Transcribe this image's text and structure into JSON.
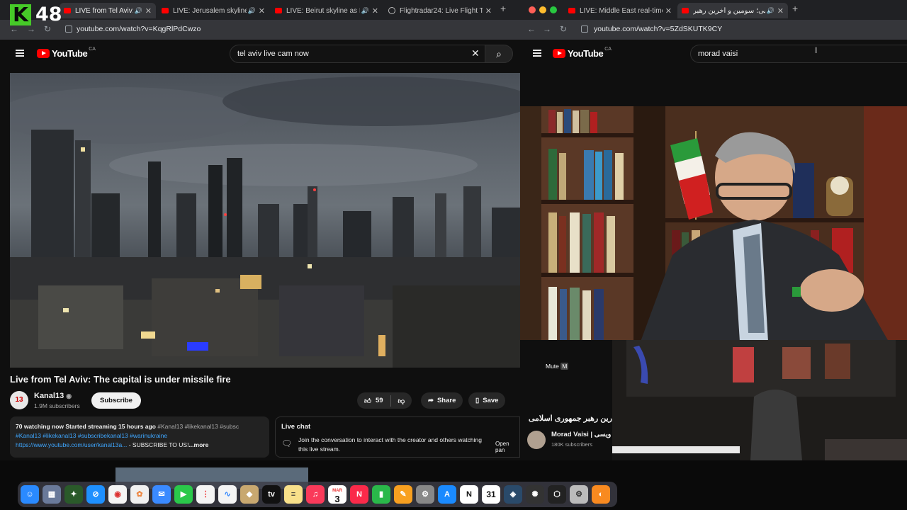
{
  "left_window": {
    "tabs": [
      {
        "title": "LIVE from Tel Aviv: The ca",
        "active": true
      },
      {
        "title": "LIVE: Jerusalem skyline a",
        "active": false
      },
      {
        "title": "LIVE: Beirut skyline as Isr",
        "active": false
      },
      {
        "title": "Flightradar24: Live Flight Tra",
        "active": false
      }
    ],
    "url": "youtube.com/watch?v=KqgRlPdCwzo",
    "search_query": "tel aviv live cam now",
    "video": {
      "title": "Live from Tel Aviv: The capital is under missile fire",
      "channel": "Kanal13",
      "channel_avatar": "13",
      "subscribers": "1.9M subscribers",
      "subscribe_label": "Subscribe",
      "likes": "59",
      "share_label": "Share",
      "save_label": "Save",
      "description_line1_a": "70 watching now  Started streaming 15 hours ago",
      "description_line1_b": "#Kanal13 #likekanal13 #subsc",
      "description_line2": "#Kanal13 #likekanal13 #subscribekanal13 #warinukraine",
      "description_line3_link": "https://www.youtube.com/user/kanal13a...",
      "description_line3_text": "- SUBSCRIBE TO US!",
      "more_label": "...more"
    },
    "live_chat": {
      "title": "Live chat",
      "message": "Join the conversation to interact with the creator and others watching this live stream.",
      "open_panel": "Open pan"
    }
  },
  "right_window": {
    "tabs": [
      {
        "title": "LIVE: Middle East real-time c",
        "active": false
      },
      {
        "title": "مجتبی؛ سومین و آخرین رهبر |",
        "active": true
      }
    ],
    "url": "youtube.com/watch?v=5ZdSKUTK9CY",
    "search_query": "morad vaisi",
    "video": {
      "mute_label": "Mute",
      "mute_key": "M",
      "title_fragment": "رین رهبر جمهوری اسلامی",
      "channel": "Morad Vaisi | ویسی",
      "subscribers": "180K subscribers"
    }
  },
  "overlay": {
    "logo_letter": "K",
    "number": "48"
  },
  "youtube": {
    "word": "YouTube",
    "country": "CA"
  },
  "dock": {
    "calendar_month": "MAR",
    "calendar_day": "3",
    "calendar2_day": "31",
    "items": [
      "finder",
      "launchpad",
      "app",
      "safari",
      "chrome",
      "photos",
      "mail",
      "facetime",
      "reminders",
      "freeform",
      "app2",
      "appletv",
      "notes",
      "music",
      "calendar",
      "news",
      "numbers",
      "pages",
      "settings",
      "appstore",
      "notion",
      "calendar2",
      "app3",
      "app4",
      "app5",
      "app6",
      "app7"
    ]
  },
  "colors": {
    "yt_red": "#ff0000",
    "link_blue": "#3ea6ff",
    "k_green": "#46c928"
  }
}
